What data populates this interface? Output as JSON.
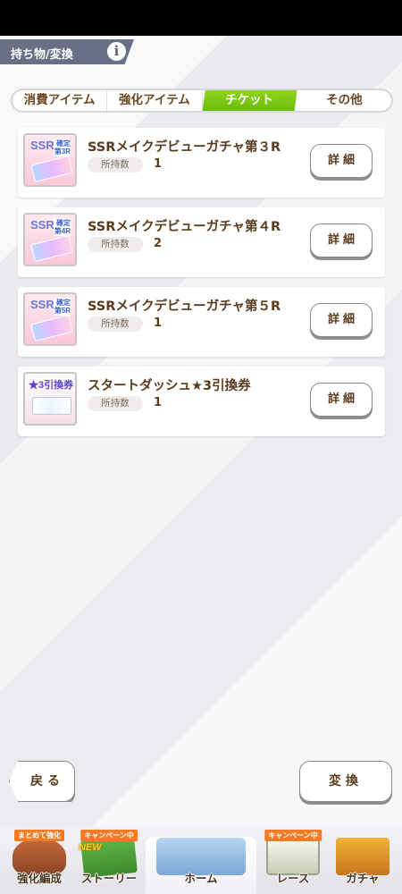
{
  "header": {
    "title": "持ち物/変換",
    "info_icon": "i"
  },
  "tabs": [
    {
      "label": "消費アイテム",
      "active": false
    },
    {
      "label": "強化アイテム",
      "active": false
    },
    {
      "label": "チケット",
      "active": true
    },
    {
      "label": "その他",
      "active": false
    }
  ],
  "items": [
    {
      "name": "SSRメイクデビューガチャ第３R",
      "owned_label": "所持数",
      "owned": "1",
      "badge": "SSR",
      "badge_sub": "確定\n第3R",
      "detail_label": "詳細"
    },
    {
      "name": "SSRメイクデビューガチャ第４R",
      "owned_label": "所持数",
      "owned": "2",
      "badge": "SSR",
      "badge_sub": "確定\n第4R",
      "detail_label": "詳細"
    },
    {
      "name": "SSRメイクデビューガチャ第５R",
      "owned_label": "所持数",
      "owned": "1",
      "badge": "SSR",
      "badge_sub": "確定\n第5R",
      "detail_label": "詳細"
    },
    {
      "name": "スタートダッシュ★3引換券",
      "owned_label": "所持数",
      "owned": "1",
      "badge": "★3引換券",
      "badge_sub": "",
      "detail_label": "詳細"
    }
  ],
  "footer": {
    "back_label": "戻る",
    "exchange_label": "変換"
  },
  "nav": [
    {
      "label": "強化編成",
      "tag": "まとめて強化"
    },
    {
      "label": "ストーリー",
      "tag": "キャンペーン中",
      "new": "NEW"
    },
    {
      "label": "ホーム",
      "tag": ""
    },
    {
      "label": "レース",
      "tag": "キャンペーン中"
    },
    {
      "label": "ガチャ",
      "tag": ""
    }
  ],
  "colors": {
    "accent_green": "#7cc414",
    "title_bar": "#6a6f86",
    "text_brown": "#5a3b1e",
    "tag_orange": "#f27b25"
  }
}
